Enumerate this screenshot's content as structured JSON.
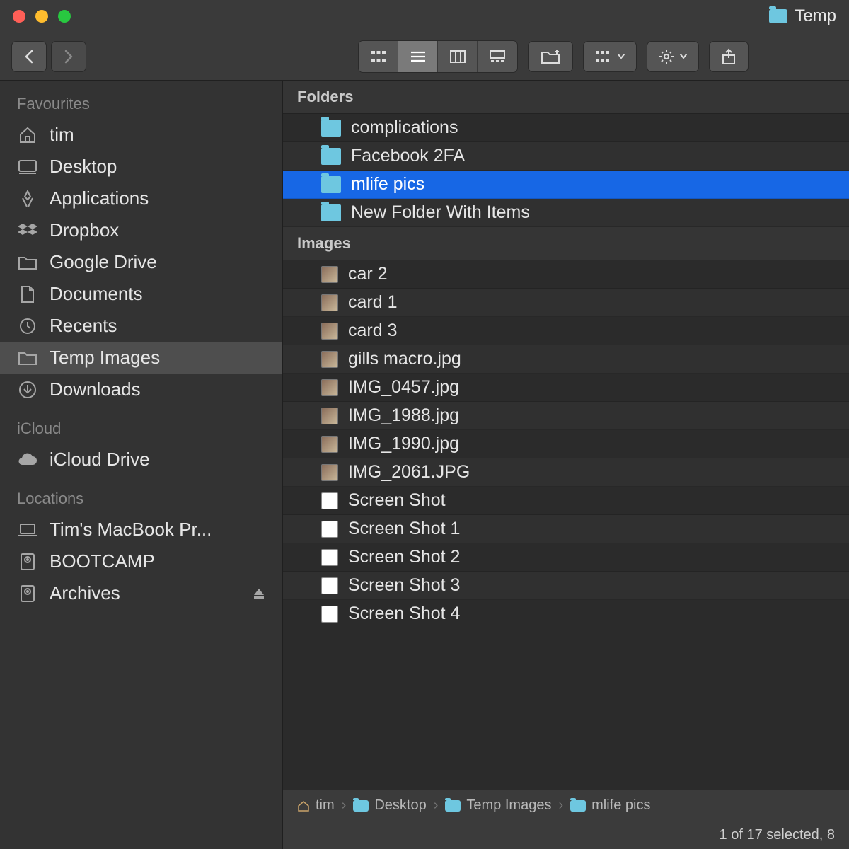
{
  "window": {
    "title": "Temp"
  },
  "sidebar": {
    "sections": [
      {
        "header": "Favourites",
        "items": [
          {
            "icon": "home",
            "label": "tim"
          },
          {
            "icon": "desktop",
            "label": "Desktop"
          },
          {
            "icon": "apps",
            "label": "Applications"
          },
          {
            "icon": "dropbox",
            "label": "Dropbox"
          },
          {
            "icon": "folder",
            "label": "Google Drive"
          },
          {
            "icon": "doc",
            "label": "Documents"
          },
          {
            "icon": "recents",
            "label": "Recents"
          },
          {
            "icon": "folder",
            "label": "Temp Images",
            "selected": true
          },
          {
            "icon": "download",
            "label": "Downloads"
          }
        ]
      },
      {
        "header": "iCloud",
        "items": [
          {
            "icon": "cloud",
            "label": "iCloud Drive"
          }
        ]
      },
      {
        "header": "Locations",
        "items": [
          {
            "icon": "laptop",
            "label": "Tim's MacBook Pr..."
          },
          {
            "icon": "disk",
            "label": "BOOTCAMP"
          },
          {
            "icon": "disk",
            "label": "Archives",
            "eject": true
          }
        ]
      }
    ]
  },
  "content": {
    "groups": [
      {
        "header": "Folders",
        "type": "folder",
        "items": [
          {
            "name": "complications"
          },
          {
            "name": "Facebook 2FA"
          },
          {
            "name": "mlife pics",
            "selected": true
          },
          {
            "name": "New Folder With Items"
          }
        ]
      },
      {
        "header": "Images",
        "type": "image",
        "items": [
          {
            "name": "car 2",
            "thumb": "img"
          },
          {
            "name": "card 1",
            "thumb": "img"
          },
          {
            "name": "card 3",
            "thumb": "img"
          },
          {
            "name": "gills macro.jpg",
            "thumb": "img"
          },
          {
            "name": "IMG_0457.jpg",
            "thumb": "img"
          },
          {
            "name": "IMG_1988.jpg",
            "thumb": "img"
          },
          {
            "name": "IMG_1990.jpg",
            "thumb": "img"
          },
          {
            "name": "IMG_2061.JPG",
            "thumb": "img"
          },
          {
            "name": "Screen Shot",
            "thumb": "blank"
          },
          {
            "name": "Screen Shot 1",
            "thumb": "blank"
          },
          {
            "name": "Screen Shot 2",
            "thumb": "blank"
          },
          {
            "name": "Screen Shot 3",
            "thumb": "blank"
          },
          {
            "name": "Screen Shot 4",
            "thumb": "blank"
          }
        ]
      }
    ]
  },
  "pathbar": {
    "crumbs": [
      {
        "icon": "home",
        "label": "tim"
      },
      {
        "icon": "folder",
        "label": "Desktop"
      },
      {
        "icon": "folder",
        "label": "Temp Images"
      },
      {
        "icon": "folder",
        "label": "mlife pics"
      }
    ]
  },
  "status": {
    "text": "1 of 17 selected, 8"
  }
}
